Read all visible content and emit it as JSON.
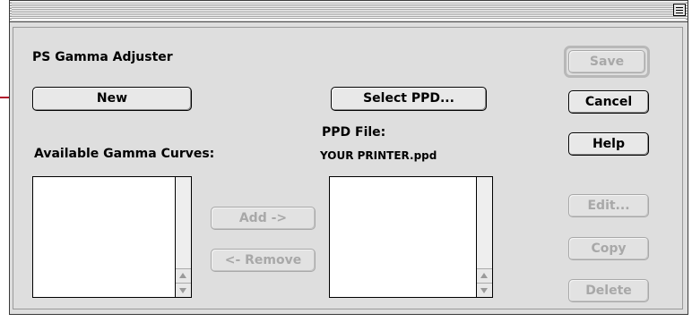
{
  "window": {
    "title": "PS Gamma Adjuster"
  },
  "buttons": {
    "new": "New",
    "select_ppd": "Select PPD...",
    "save": "Save",
    "cancel": "Cancel",
    "help": "Help",
    "add": "Add ->",
    "remove": "<- Remove",
    "edit": "Edit...",
    "copy": "Copy",
    "delete": "Delete"
  },
  "labels": {
    "available_curves": "Available Gamma Curves:",
    "ppd_file": "PPD File:",
    "ppd_filename": "YOUR PRINTER.ppd"
  },
  "colors": {
    "callout": "#c0102e"
  }
}
